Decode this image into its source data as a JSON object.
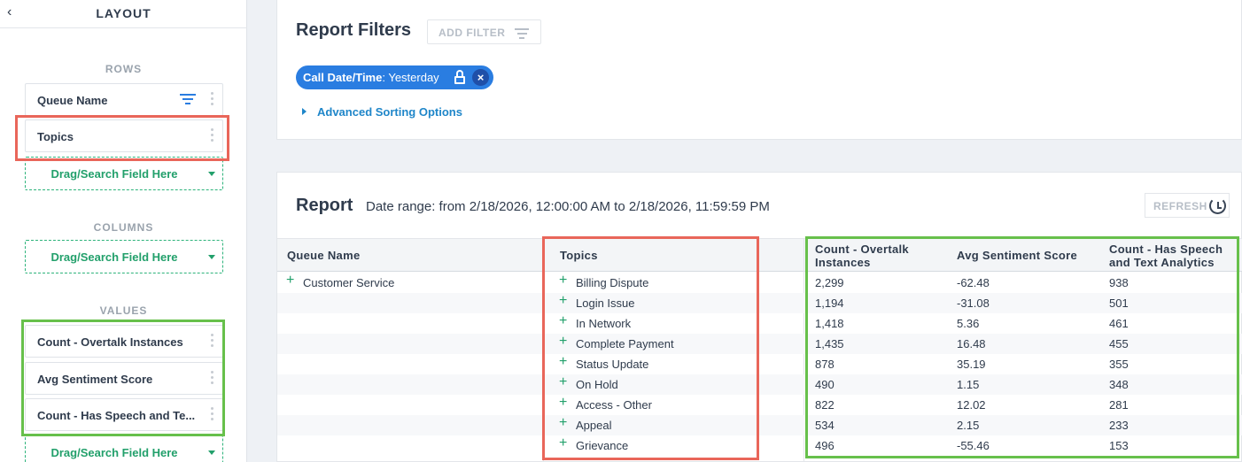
{
  "sidebar": {
    "title": "LAYOUT",
    "back_icon": "chevron-left-icon",
    "rows_label": "ROWS",
    "rows": [
      {
        "label": "Queue Name",
        "has_filter": true
      },
      {
        "label": "Topics",
        "has_filter": false
      }
    ],
    "columns_label": "COLUMNS",
    "values_label": "VALUES",
    "values": [
      {
        "label": "Count - Overtalk Instances"
      },
      {
        "label": "Avg Sentiment Score"
      },
      {
        "label": "Count - Has Speech and Te..."
      }
    ],
    "dropzone_label": "Drag/Search Field Here"
  },
  "filters": {
    "title": "Report Filters",
    "add_filter_label": "ADD FILTER",
    "chip": {
      "field": "Call Date/Time",
      "value": ": Yesterday"
    },
    "advanced_label": "Advanced Sorting Options"
  },
  "report": {
    "title": "Report",
    "date_range": "Date range: from 2/18/2026, 12:00:00 AM to 2/18/2026, 11:59:59 PM",
    "refresh_label": "REFRESH",
    "columns": {
      "queue": "Queue Name",
      "topics": "Topics",
      "overtalk": "Count - Overtalk\nInstances",
      "sentiment": "Avg Sentiment Score",
      "speech": "Count - Has Speech\nand Text Analytics"
    },
    "queue_value": "Customer Service",
    "rows": [
      {
        "topic": "Billing Dispute",
        "overtalk": "2,299",
        "sentiment": "-62.48",
        "speech": "938"
      },
      {
        "topic": "Login Issue",
        "overtalk": "1,194",
        "sentiment": "-31.08",
        "speech": "501"
      },
      {
        "topic": "In Network",
        "overtalk": "1,418",
        "sentiment": "5.36",
        "speech": "461"
      },
      {
        "topic": "Complete Payment",
        "overtalk": "1,435",
        "sentiment": "16.48",
        "speech": "455"
      },
      {
        "topic": "Status Update",
        "overtalk": "878",
        "sentiment": "35.19",
        "speech": "355"
      },
      {
        "topic": "On Hold",
        "overtalk": "490",
        "sentiment": "1.15",
        "speech": "348"
      },
      {
        "topic": "Access - Other",
        "overtalk": "822",
        "sentiment": "12.02",
        "speech": "281"
      },
      {
        "topic": "Appeal",
        "overtalk": "534",
        "sentiment": "2.15",
        "speech": "233"
      },
      {
        "topic": "Grievance",
        "overtalk": "496",
        "sentiment": "-55.46",
        "speech": "153"
      }
    ]
  },
  "colors": {
    "accent": "#2a7de1",
    "green": "#22a06b",
    "highlight_red": "#e9665a",
    "highlight_green": "#67c04b"
  }
}
